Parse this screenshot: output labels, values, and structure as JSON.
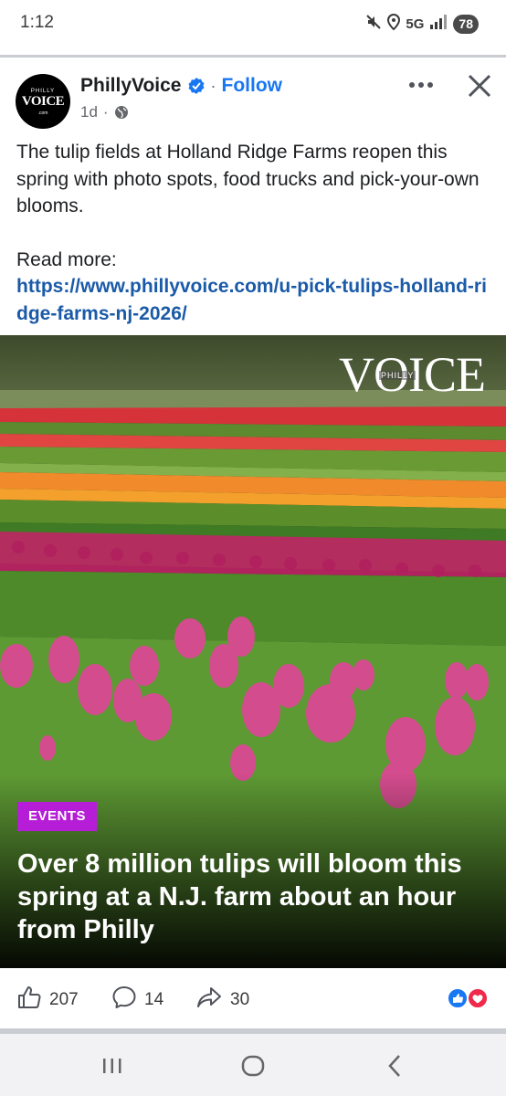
{
  "status_bar": {
    "time": "1:12",
    "network": "5G",
    "battery": "78",
    "icons": [
      "mute-icon",
      "location-icon",
      "signal-icon"
    ]
  },
  "post": {
    "page_name": "PhillyVoice",
    "separator": "·",
    "follow_label": "Follow",
    "time_ago": "1d",
    "meta_separator": "·",
    "avatar": {
      "top": "PHILLY",
      "main": "VOICE",
      "bottom": ".com"
    },
    "text_line": "The tulip fields at Holland Ridge Farms reopen this spring with photo spots, food trucks and pick-your-own blooms.",
    "read_more_label": "Read more:",
    "link_url": "https://www.phillyvoice.com/u-pick-tulips-holland-ridge-farms-nj-2026/"
  },
  "card": {
    "logo_main": "VOICE",
    "logo_small": "PHILLY",
    "category": "EVENTS",
    "headline": "Over 8 million tulips will bloom this spring at a N.J. farm about an hour from Philly"
  },
  "engagement": {
    "likes": "207",
    "comments": "14",
    "shares": "30"
  },
  "colors": {
    "link": "#1a5aa8",
    "follow": "#1877f2",
    "badge": "#b51ed6",
    "like_reaction": "#1877f2",
    "love_reaction": "#f0284a"
  },
  "nav": {
    "icons": [
      "recent-apps-icon",
      "home-icon",
      "back-icon"
    ]
  }
}
